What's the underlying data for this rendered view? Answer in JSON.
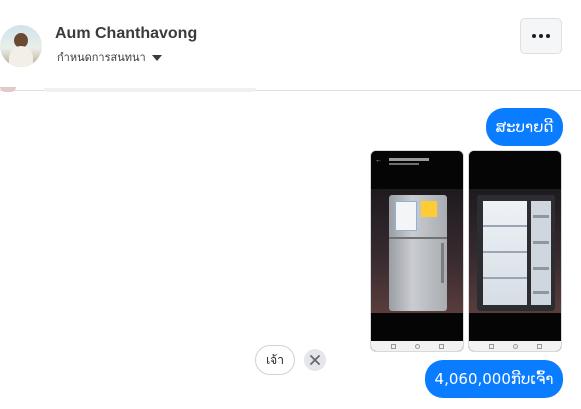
{
  "header": {
    "contact_name": "Aum Chanthavong",
    "subtitle": "กำหนดการสนทนา",
    "avatar_icon": "profile-photo",
    "more_icon": "more-dots-icon"
  },
  "messages": {
    "greeting": "ສະບາຍດີ",
    "photos": [
      {
        "description_icon": "fridge-closed-photo"
      },
      {
        "description_icon": "fridge-open-photo"
      }
    ],
    "price": "4,060,000ກີບເຈົ້າ"
  },
  "quick_replies": {
    "items": [
      "เจ้า"
    ],
    "dismiss_icon": "close-icon"
  },
  "colors": {
    "outgoing_bubble": "#0a7cff",
    "header_border": "#dddfe2"
  }
}
